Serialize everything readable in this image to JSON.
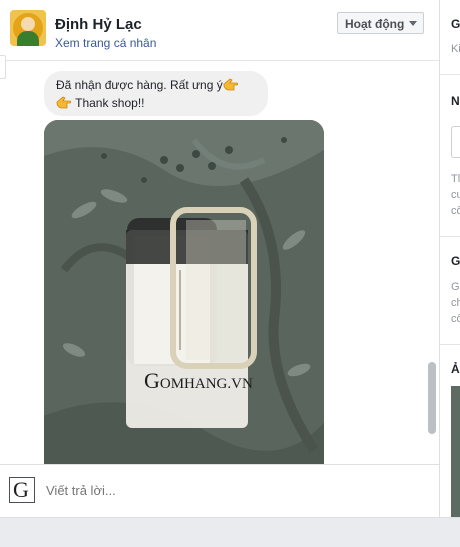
{
  "header": {
    "name": "Định Hỷ Lạc",
    "profile_link": "Xem trang cá nhân",
    "status_label": "Hoạt động"
  },
  "message": {
    "line1": "Đã nhận được hàng. Rất ưng ý",
    "line2": "Thank shop!!",
    "emoji": "pointing-hand"
  },
  "photo": {
    "watermark_first": "G",
    "watermark_rest": "OMHANG.VN"
  },
  "reply": {
    "avatar_letter": "G",
    "placeholder": "Viết trả lời..."
  },
  "right_column": {
    "h1": "G",
    "sub1": "Ki",
    "h2": "N",
    "t2a": "Tl",
    "t2b": "cu",
    "t2c": "cô",
    "h3": "G",
    "t3a": "G",
    "t3b": "ch",
    "t3c": "cô",
    "h4": "Ả"
  },
  "colors": {
    "link": "#385898",
    "bubble": "#f1f0f0",
    "footer": "#e9ebee"
  }
}
